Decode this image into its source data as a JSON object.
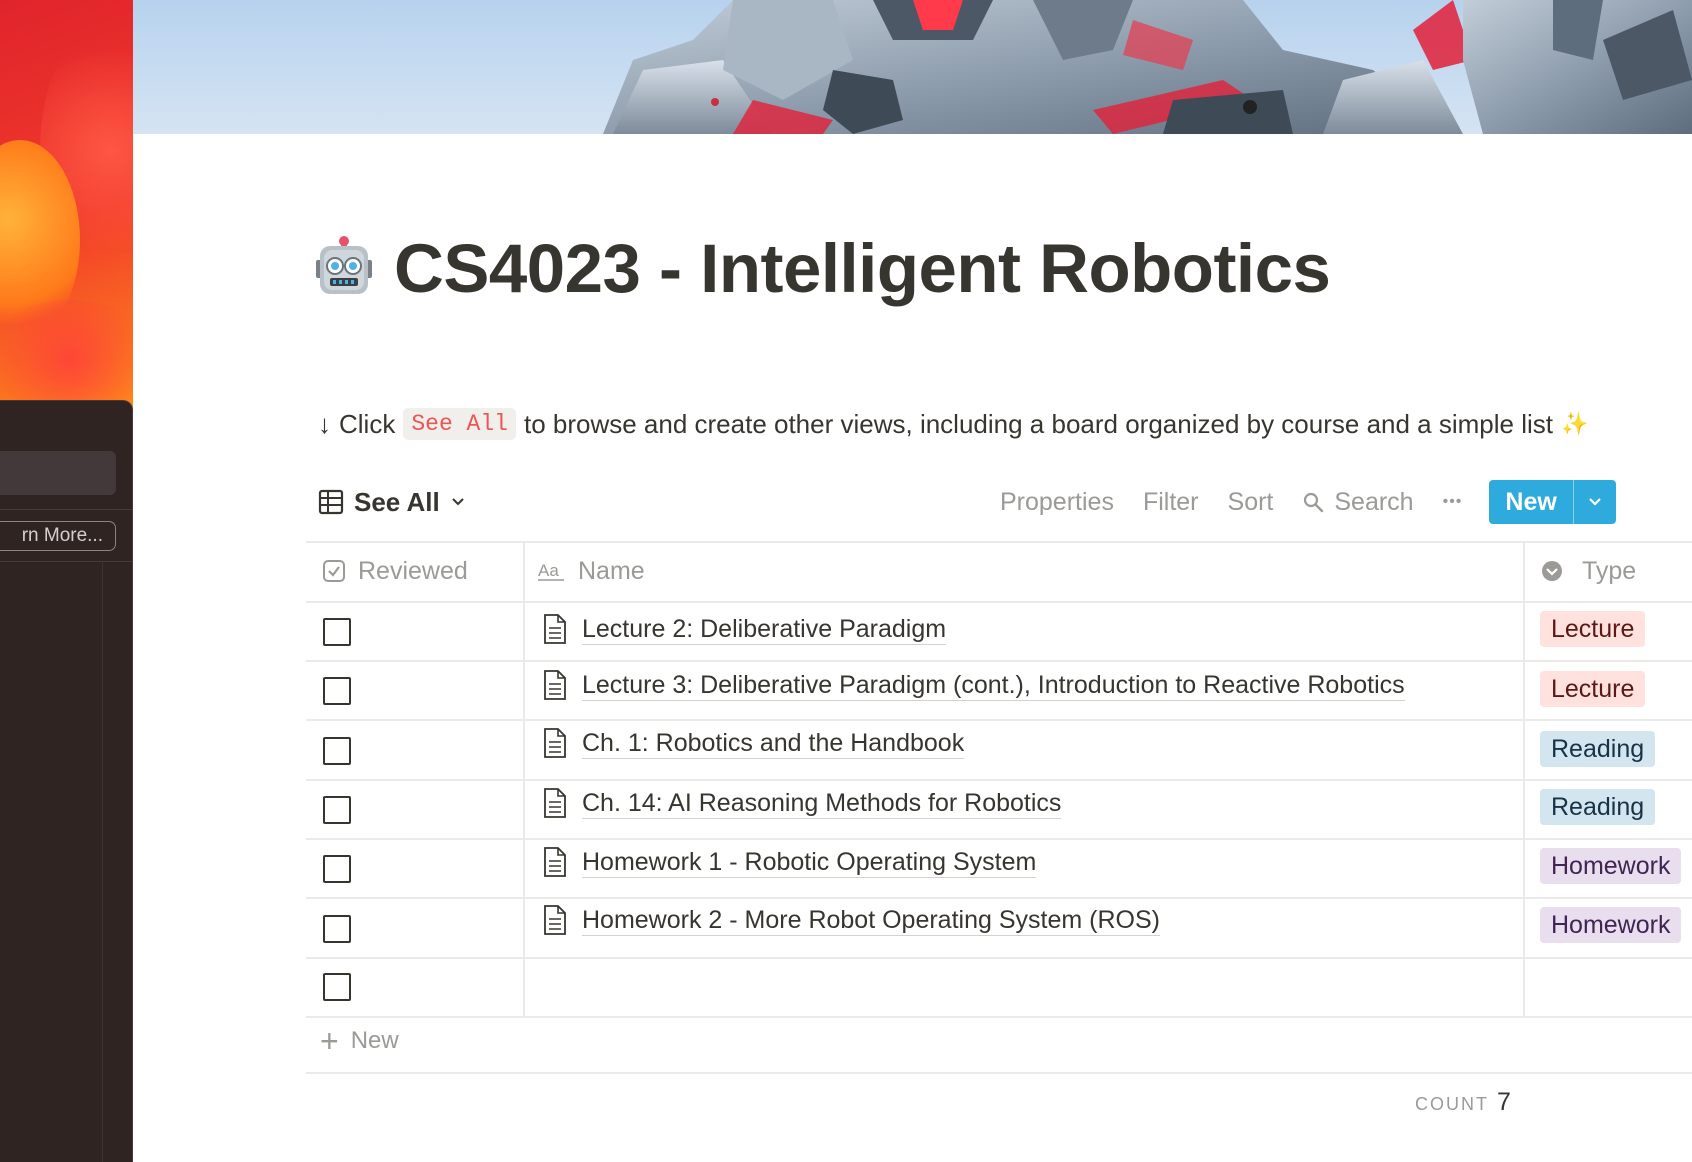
{
  "desktop": {
    "learn_more_label": "rn More..."
  },
  "page": {
    "icon": "robot-face-icon",
    "title": "CS4023 - Intelligent Robotics",
    "hint": {
      "arrow": "↓",
      "before": "Click",
      "code": "See All",
      "after": "to browse and create other views, including a board organized by course and a simple list",
      "sparkle": "✨"
    }
  },
  "view": {
    "icon": "table-icon",
    "label": "See All"
  },
  "toolbar": {
    "properties": "Properties",
    "filter": "Filter",
    "sort": "Sort",
    "search": "Search",
    "more": "•••",
    "new": "New"
  },
  "table": {
    "columns": [
      {
        "label": "Reviewed",
        "icon": "checkbox-property-icon"
      },
      {
        "label": "Name",
        "icon": "title-property-icon"
      },
      {
        "label": "Type",
        "icon": "select-property-icon"
      }
    ],
    "rows": [
      {
        "reviewed": false,
        "name": "Lecture 2: Deliberative Paradigm",
        "type": "Lecture"
      },
      {
        "reviewed": false,
        "name": "Lecture 3: Deliberative Paradigm (cont.), Introduction to Reactive Robotics",
        "type": "Lecture"
      },
      {
        "reviewed": false,
        "name": "Ch. 1: Robotics and the Handbook",
        "type": "Reading"
      },
      {
        "reviewed": false,
        "name": "Ch. 14: AI Reasoning Methods for Robotics",
        "type": "Reading"
      },
      {
        "reviewed": false,
        "name": "Homework 1 - Robotic Operating System",
        "type": "Homework"
      },
      {
        "reviewed": false,
        "name": "Homework 2 - More Robot Operating System (ROS)",
        "type": "Homework"
      },
      {
        "reviewed": false,
        "name": "",
        "type": ""
      }
    ],
    "new_row_label": "New",
    "count_label": "COUNT",
    "count_value": "7"
  },
  "colors": {
    "accent_blue": "#2eaadc",
    "tag_lecture_bg": "#ffe2dd",
    "tag_reading_bg": "#d3e5ef",
    "tag_homework_bg": "#e8deee",
    "inline_code": "#eb5757"
  }
}
